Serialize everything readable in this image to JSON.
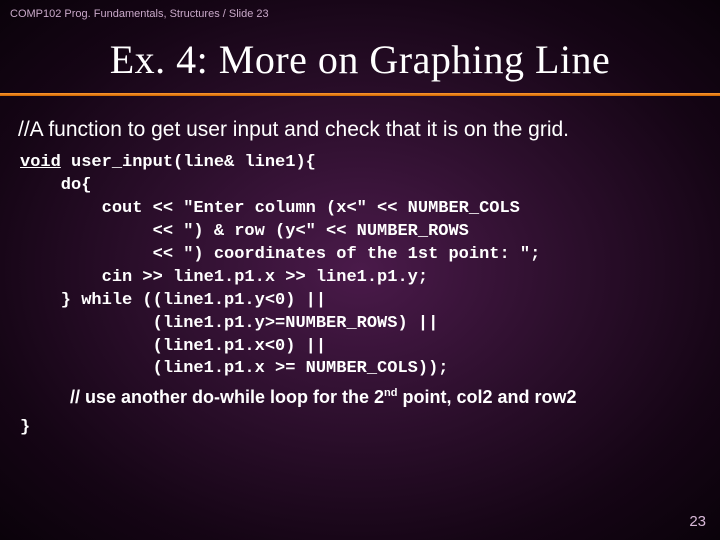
{
  "header": "COMP102 Prog. Fundamentals, Structures / Slide 23",
  "title": "Ex. 4: More on Graphing Line",
  "comment": "//A function to get user input and check that it is on the grid.",
  "code": {
    "l1a": "void",
    "l1b": " user_input(line& line1){",
    "l2": "    do{",
    "l3": "        cout << \"Enter column (x<\" << NUMBER_COLS",
    "l4": "             << \") & row (y<\" << NUMBER_ROWS",
    "l5": "             << \") coordinates of the 1st point: \";",
    "l6": "        cin >> line1.p1.x >> line1.p1.y;",
    "l7": "    } while ((line1.p1.y<0) ||",
    "l8": "             (line1.p1.y>=NUMBER_ROWS) ||",
    "l9": "             (line1.p1.x<0) ||",
    "l10": "             (line1.p1.x >= NUMBER_COLS));",
    "close": "}"
  },
  "note": {
    "prefix": "// use another do-while loop for the 2",
    "sup1": "nd",
    "mid": " point, col2 and row2"
  },
  "pagenum": "23"
}
